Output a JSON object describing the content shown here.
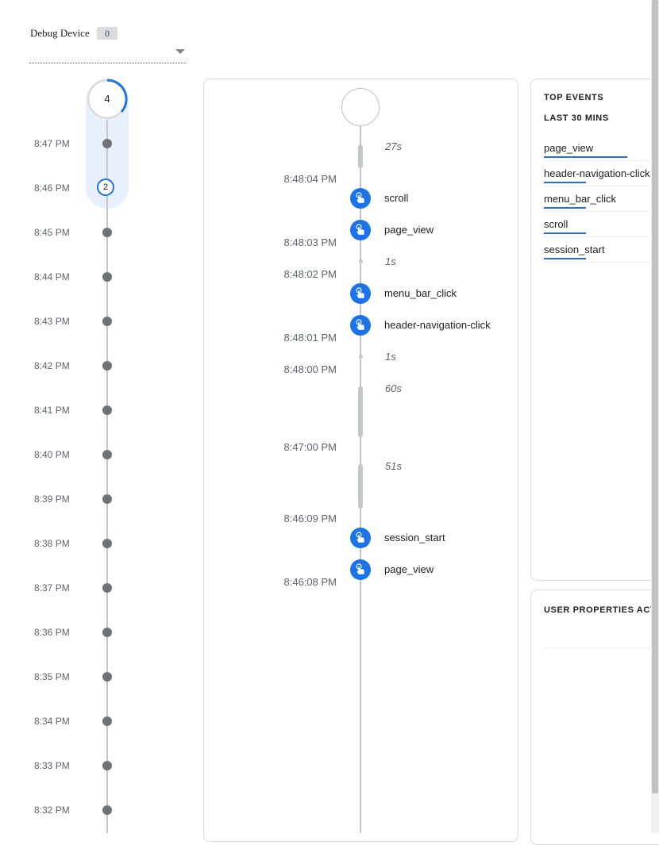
{
  "debug_device": {
    "label": "Debug Device",
    "count": "0"
  },
  "minutes": {
    "top_count": "4",
    "active_count": "2",
    "labels": [
      "8:47 PM",
      "8:46 PM",
      "8:45 PM",
      "8:44 PM",
      "8:43 PM",
      "8:42 PM",
      "8:41 PM",
      "8:40 PM",
      "8:39 PM",
      "8:38 PM",
      "8:37 PM",
      "8:36 PM",
      "8:35 PM",
      "8:34 PM",
      "8:33 PM",
      "8:32 PM"
    ]
  },
  "seconds": {
    "times": [
      "8:48:04 PM",
      "8:48:03 PM",
      "8:48:02 PM",
      "8:48:01 PM",
      "8:48:00 PM",
      "8:47:00 PM",
      "8:46:09 PM",
      "8:46:08 PM"
    ],
    "gaps": [
      "27s",
      "1s",
      "1s",
      "60s",
      "51s"
    ],
    "events": [
      "scroll",
      "page_view",
      "menu_bar_click",
      "header-navigation-click",
      "session_start",
      "page_view"
    ]
  },
  "top_events": {
    "title": "TOP EVENTS",
    "subtitle": "LAST 30 MINS",
    "items": [
      {
        "name": "page_view",
        "share": 1.0
      },
      {
        "name": "header-navigation-click",
        "share": 0.5
      },
      {
        "name": "menu_bar_click",
        "share": 0.5
      },
      {
        "name": "scroll",
        "share": 0.5
      },
      {
        "name": "session_start",
        "share": 0.5
      }
    ]
  },
  "user_properties": {
    "title": "USER PROPERTIES ACTI"
  },
  "colors": {
    "accent": "#1a73e8",
    "highlight": "#e8f0fe",
    "dot": "#6f7377",
    "line": "#c4c7c5"
  },
  "icons": {
    "event": "touch-icon",
    "dropdown": "triangle-down-icon"
  }
}
